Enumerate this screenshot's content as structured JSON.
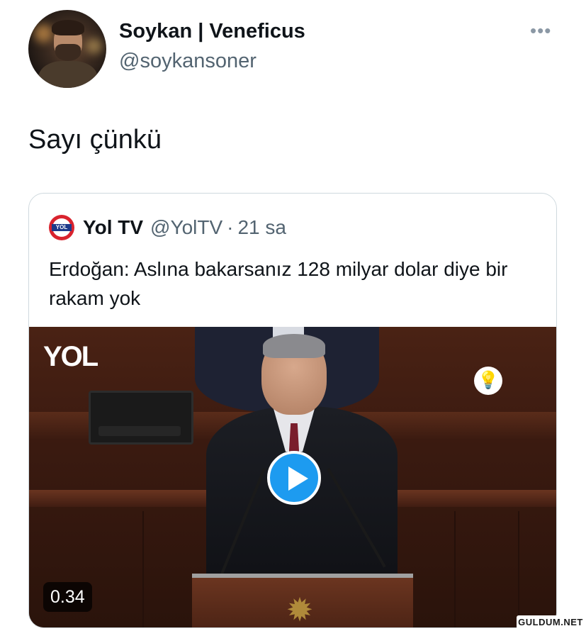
{
  "tweet": {
    "author_name": "Soykan | Veneficus",
    "author_handle": "@soykansoner",
    "more_icon": "more-horizontal-icon",
    "text": "Sayı çünkü"
  },
  "quoted_tweet": {
    "author_name": "Yol TV",
    "author_handle": "@YolTV",
    "separator": "·",
    "time": "21 sa",
    "avatar_text": "YOL",
    "text": "Erdoğan: Aslına bakarsanız 128 milyar dolar diye bir rakam yok",
    "media": {
      "overlay_logo": "YOL",
      "play_icon": "play-icon",
      "duration": "0.34"
    }
  },
  "watermark": "GULDUM.NET",
  "colors": {
    "accent": "#1d9bf0",
    "secondary_text": "#536471",
    "border": "#cfd9de"
  }
}
